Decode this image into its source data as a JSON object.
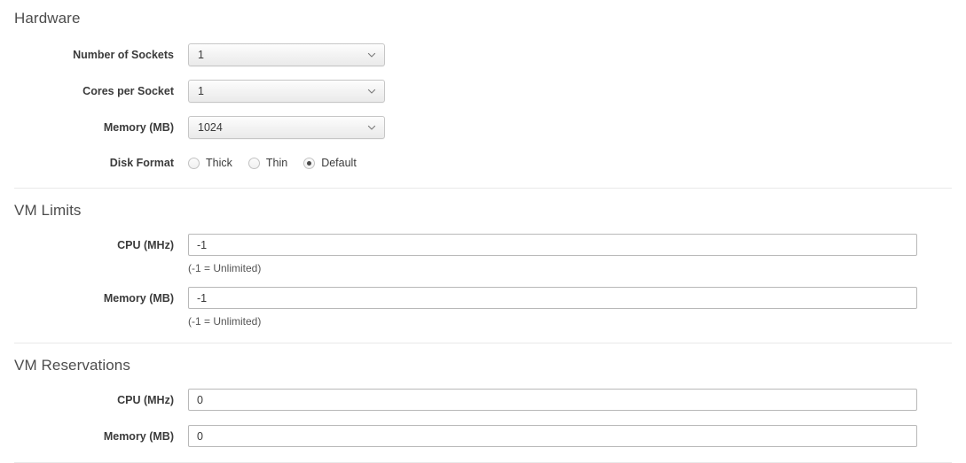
{
  "sections": [
    {
      "id": "hardware",
      "title": "Hardware",
      "rows": [
        {
          "id": "number-of-sockets",
          "label": "Number of Sockets",
          "type": "select",
          "value": "1",
          "options": [
            "1"
          ]
        },
        {
          "id": "cores-per-socket",
          "label": "Cores per Socket",
          "type": "select",
          "value": "1",
          "options": [
            "1"
          ]
        },
        {
          "id": "memory-mb",
          "label": "Memory (MB)",
          "type": "select",
          "value": "1024",
          "options": [
            "1024"
          ]
        },
        {
          "id": "disk-format",
          "label": "Disk Format",
          "type": "radio",
          "value": "Default",
          "options": [
            {
              "label": "Thick",
              "checked": false
            },
            {
              "label": "Thin",
              "checked": false
            },
            {
              "label": "Default",
              "checked": true
            }
          ]
        }
      ]
    },
    {
      "id": "vm-limits",
      "title": "VM Limits",
      "rows": [
        {
          "id": "limits-cpu-mhz",
          "label": "CPU (MHz)",
          "type": "text",
          "value": "-1",
          "placeholder": "",
          "help": "(-1 = Unlimited)"
        },
        {
          "id": "limits-memory-mb",
          "label": "Memory (MB)",
          "type": "text",
          "value": "-1",
          "placeholder": "",
          "help": "(-1 = Unlimited)"
        }
      ]
    },
    {
      "id": "vm-reservations",
      "title": "VM Reservations",
      "rows": [
        {
          "id": "reservations-cpu-mhz",
          "label": "CPU (MHz)",
          "type": "text",
          "value": "0",
          "placeholder": "",
          "help": ""
        },
        {
          "id": "reservations-memory-mb",
          "label": "Memory (MB)",
          "type": "text",
          "value": "0",
          "placeholder": "",
          "help": ""
        }
      ]
    }
  ],
  "icons": {
    "dropdown": "chevron-down-icon"
  },
  "colors": {
    "page_background": "#ffffff",
    "section_title": "#4d4d4d",
    "label": "#3b3b3b",
    "divider": "#e9e9e9",
    "input_border": "#b8b8b8",
    "select_border": "#c6c6c6"
  }
}
